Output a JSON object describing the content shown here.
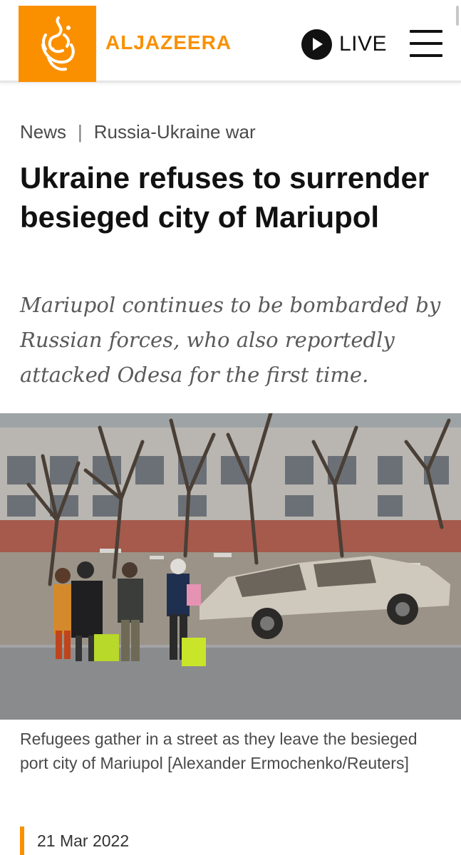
{
  "header": {
    "brand_name": "ALJAZEERA",
    "brand_color": "#fa9000",
    "logo_icon": "aljazeera-calligraphy-logo-icon",
    "live_label": "LIVE",
    "live_icon": "play-icon",
    "menu_icon": "hamburger-menu-icon"
  },
  "breadcrumb": {
    "section": "News",
    "separator": "|",
    "topic": "Russia-Ukraine war"
  },
  "article": {
    "headline": "Ukraine refuses to surrender besieged city of Mariupol",
    "standfirst": "Mariupol continues to be bombarded by Russian forces, who also reportedly attacked Odesa for the first time.",
    "image_caption": "Refugees gather in a street as they leave the besieged port city of Mariupol [Alexander Ermochenko/Reuters]",
    "date": "21 Mar 2022"
  }
}
